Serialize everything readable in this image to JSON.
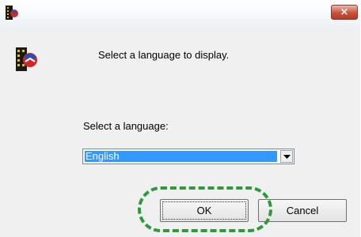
{
  "titlebar": {
    "close_label": "×"
  },
  "dialog": {
    "prompt": "Select a language to display.",
    "language_label": "Select a language:",
    "language_value": "English"
  },
  "buttons": {
    "ok_label": "OK",
    "cancel_label": "Cancel"
  },
  "icons": {
    "app": "app-logo-icon",
    "dropdown": "chevron-down-icon",
    "close": "close-icon"
  },
  "colors": {
    "selection": "#3399ff",
    "annotation": "#2e9a3a",
    "close": "#c7513b"
  }
}
